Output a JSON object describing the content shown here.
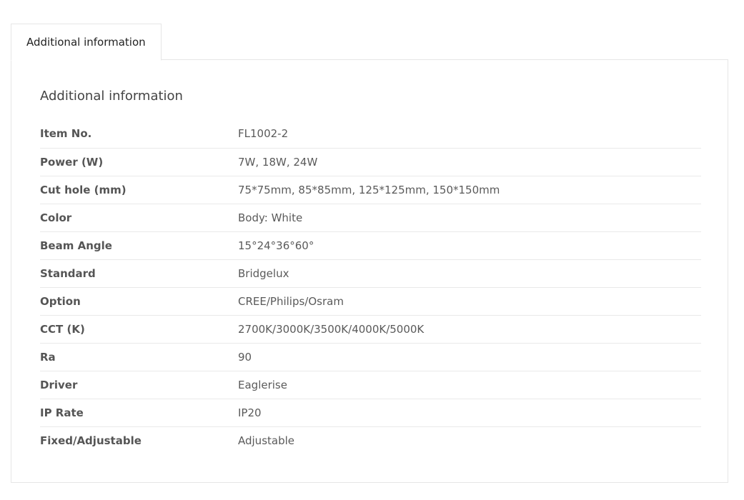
{
  "tabs": [
    {
      "label": "Additional information"
    }
  ],
  "panel": {
    "title": "Additional information"
  },
  "attributes": [
    {
      "label": "Item No.",
      "value": "FL1002-2"
    },
    {
      "label": "Power (W)",
      "value": "7W, 18W, 24W"
    },
    {
      "label": "Cut hole (mm)",
      "value": "75*75mm, 85*85mm, 125*125mm, 150*150mm"
    },
    {
      "label": "Color",
      "value": "Body: White"
    },
    {
      "label": "Beam Angle",
      "value": "15°24°36°60°"
    },
    {
      "label": "Standard",
      "value": "Bridgelux"
    },
    {
      "label": "Option",
      "value": "CREE/Philips/Osram"
    },
    {
      "label": "CCT (K)",
      "value": "2700K/3000K/3500K/4000K/5000K"
    },
    {
      "label": "Ra",
      "value": "90"
    },
    {
      "label": "Driver",
      "value": "Eaglerise"
    },
    {
      "label": "IP Rate",
      "value": "IP20"
    },
    {
      "label": "Fixed/Adjustable",
      "value": "Adjustable"
    }
  ]
}
